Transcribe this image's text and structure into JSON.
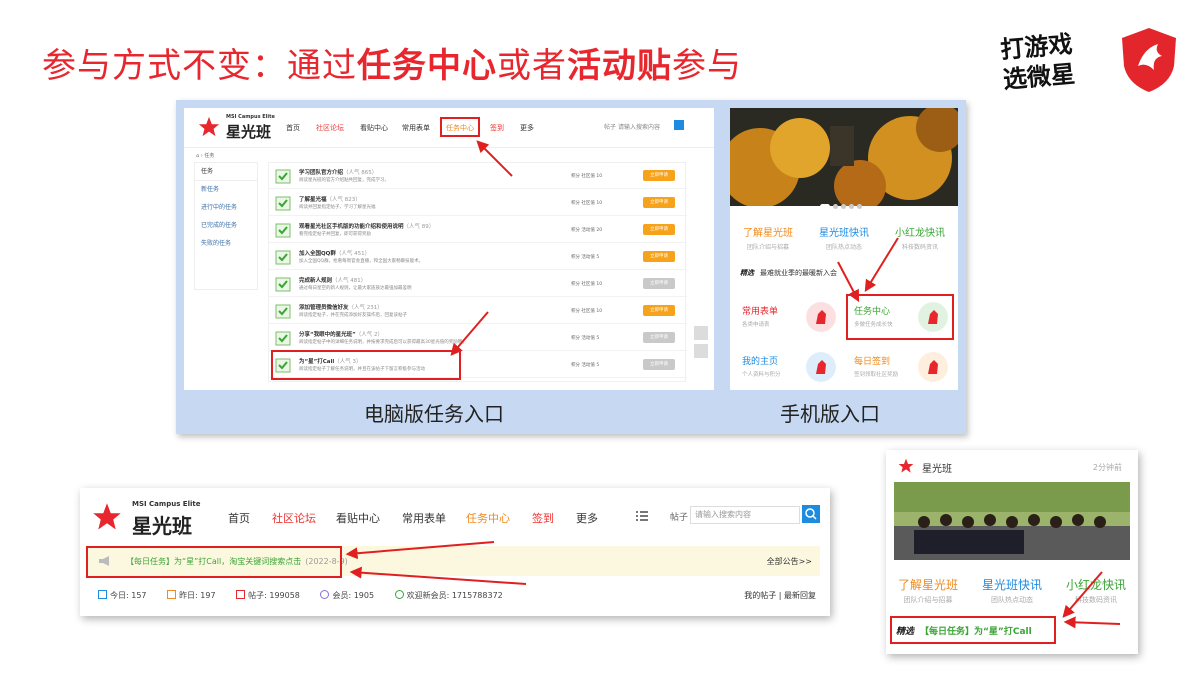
{
  "slide": {
    "title_parts": [
      "参与方式不变：通过",
      "任务中心",
      "或者",
      "活动贴",
      "参与"
    ],
    "brand_line1": "打游戏",
    "brand_line2": "选微星"
  },
  "colors": {
    "red": "#e8262d",
    "orange": "#f08a1c",
    "green": "#3aa535",
    "blue": "#1d8ce0"
  },
  "pc": {
    "label": "电脑版任务入口",
    "logo_sub": "MSI Campus Elite",
    "logo_name": "星光班",
    "nav": [
      "首页",
      "社区论坛",
      "看贴中心",
      "常用表单",
      "任务中心",
      "签到",
      "更多"
    ],
    "search_label": "帖子",
    "search_placeholder": "请输入搜索内容",
    "breadcrumb": "任务",
    "side": [
      "任务",
      "新任务",
      "进行中的任务",
      "已完成的任务",
      "失败的任务"
    ],
    "tasks": [
      {
        "title": "学习团队官方介绍",
        "pop": "（人气 865）",
        "desc": "阅读星光班的官方介绍贴共回复，完成学习。",
        "pts": "积分 社区值 10",
        "btn": "立即申请"
      },
      {
        "title": "了解星光福",
        "pop": "（人气 823）",
        "desc": "阅读并回复指定帖子，学习了解星光福",
        "pts": "积分 社区值 10",
        "btn": "立即申请"
      },
      {
        "title": "观看星光社区手机版的功能介绍和使用说明",
        "pop": "（人气 89）",
        "desc": "看完指定帖子并回复，即可获得奖励",
        "pts": "积分 活动值 20",
        "btn": "立即申请"
      },
      {
        "title": "加入全国QQ群",
        "pop": "（人气 451）",
        "desc": "加入全国QQ群，抢看每周官会直播，和全国大家畅聊技能术。",
        "pts": "积分 活动值 5",
        "btn": "立即申请"
      },
      {
        "title": "完成新人规则",
        "pop": "（人气 481）",
        "desc": "通过每日星空的新人规则，让最大家族族达最强加最差明",
        "pts": "积分 社区值 10",
        "btn": "立即申请"
      },
      {
        "title": "添加管理员微信好友",
        "pop": "（人气 231）",
        "desc": "阅读指定帖子，并在完成添加好友操作后，回复该帖子",
        "pts": "积分 社区值 10",
        "btn": "立即申请"
      },
      {
        "title": "分享“我眼中的星光班”",
        "pop": "（人气 2）",
        "desc": "阅读指定帖子中的详细任务说明，并按要求完成后可以获得最高30星光值的奖励哦。",
        "pts": "积分 活动值 5",
        "btn": "立即申请"
      },
      {
        "title": "为“星”打Call",
        "pop": "（人气 3）",
        "desc": "阅读指定帖子了解任务说明，并且在该帖子下留言积极参与活动",
        "pts": "积分 活动值 5",
        "btn": "立即申请"
      }
    ]
  },
  "mobile": {
    "label": "手机版入口",
    "quick": [
      {
        "t": "了解星光班",
        "s": "团队介绍与招募",
        "c": "#f08a1c"
      },
      {
        "t": "星光班快讯",
        "s": "团队热点动态",
        "c": "#1d8ce0"
      },
      {
        "t": "小红龙快讯",
        "s": "科技数码资讯",
        "c": "#3aa535"
      }
    ],
    "featured_tag": "精选",
    "featured_text": "最难就业季的最暖新入会",
    "tiles": [
      {
        "t": "常用表单",
        "s": "各类申请表",
        "c": "#e8262d"
      },
      {
        "t": "任务中心",
        "s": "多做任务成长快",
        "c": "#3aa535"
      },
      {
        "t": "我的主页",
        "s": "个人资料与积分",
        "c": "#1d8ce0"
      },
      {
        "t": "每日签到",
        "s": "签到领取社区奖励",
        "c": "#f08a1c"
      }
    ]
  },
  "forum": {
    "logo_sub": "MSI Campus Elite",
    "logo_name": "星光班",
    "nav": [
      "首页",
      "社区论坛",
      "看贴中心",
      "常用表单",
      "任务中心",
      "签到",
      "更多"
    ],
    "search_label": "帖子",
    "search_placeholder": "请输入搜索内容",
    "notice": "【每日任务】为“星”打Call，淘宝关键词搜索点击",
    "notice_date": "(2022-8-9)",
    "notice_all": "全部公告>>",
    "stats": [
      "今日: 157",
      "昨日: 197",
      "帖子: 199058",
      "会员: 1905",
      "欢迎新会员: 1715788372"
    ],
    "links": "我的帖子 | 最新回复"
  },
  "post": {
    "name": "星光班",
    "time": "2分钟前",
    "quick": [
      {
        "t": "了解星光班",
        "s": "团队介绍与招募",
        "c": "#f08a1c"
      },
      {
        "t": "星光班快讯",
        "s": "团队热点动态",
        "c": "#1d8ce0"
      },
      {
        "t": "小红龙快讯",
        "s": "科技数码资讯",
        "c": "#3aa535"
      }
    ],
    "featured_tag": "精选",
    "featured_text": "【每日任务】为“星”打Call"
  }
}
